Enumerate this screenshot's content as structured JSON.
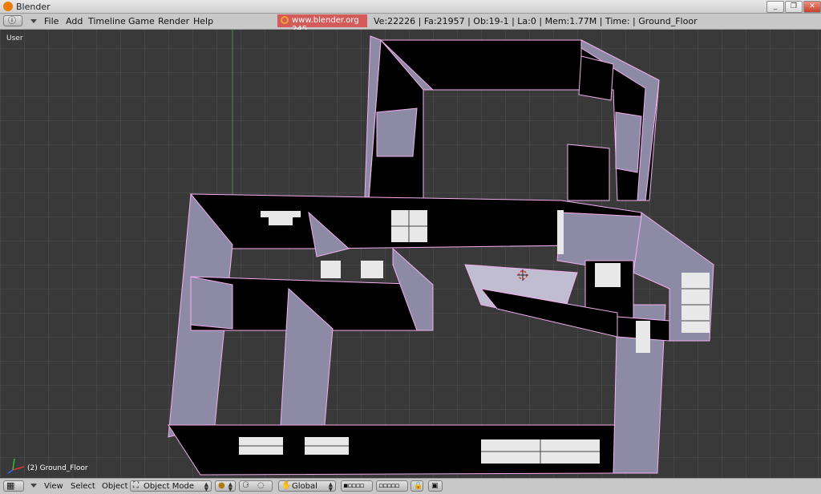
{
  "window": {
    "title": "Blender"
  },
  "info_menu": [
    "File",
    "Add",
    "Timeline",
    "Game",
    "Render",
    "Help"
  ],
  "splash": "www.blender.org 245",
  "stats": "Ve:22226 | Fa:21957 | Ob:19-1 | La:0  | Mem:1.77M  | Time: | Ground_Floor",
  "viewport": {
    "view_label": "User",
    "object_label": "(2) Ground_Floor"
  },
  "header": {
    "menus": [
      "View",
      "Select",
      "Object"
    ],
    "mode": "Object Mode",
    "orientation": "Global"
  },
  "colors": {
    "viewport_bg": "#393939",
    "wall": "#8d8aa6",
    "selection": "#f3b0f0",
    "splash": "#d55a5a"
  }
}
